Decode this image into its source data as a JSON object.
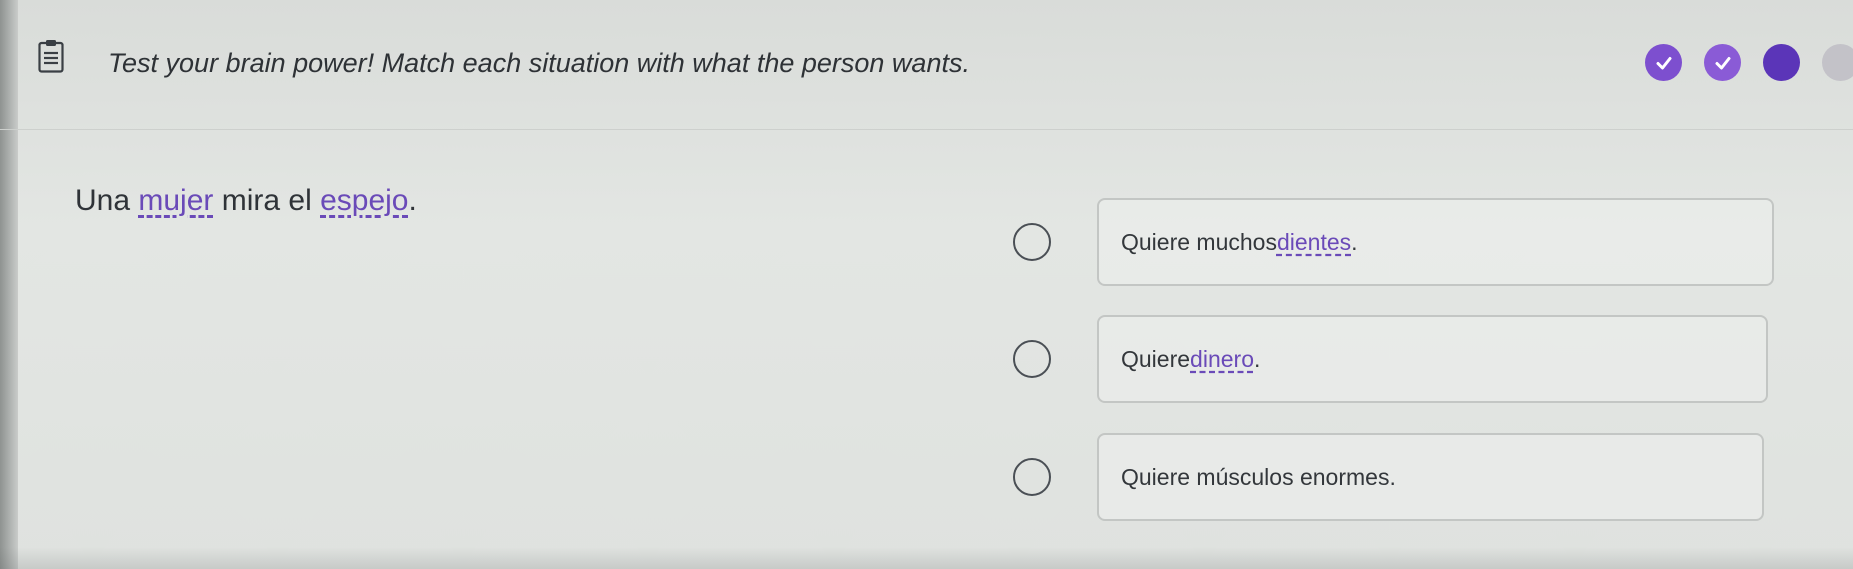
{
  "header": {
    "instruction": "Test your brain power! Match each situation with what the person wants.",
    "progress": [
      {
        "state": "done",
        "icon": "checkmark-icon"
      },
      {
        "state": "done",
        "icon": "checkmark-icon"
      },
      {
        "state": "current"
      },
      {
        "state": "todo"
      }
    ]
  },
  "question": {
    "parts": [
      "Una ",
      "mujer",
      " mira el ",
      "espejo",
      "."
    ]
  },
  "options": [
    {
      "parts": [
        "Quiere muchos ",
        "dientes",
        "."
      ]
    },
    {
      "parts": [
        "Quiere ",
        "dinero",
        "."
      ]
    },
    {
      "parts": [
        "Quiere músculos enormes."
      ]
    }
  ],
  "colors": {
    "accent": "#7d4fcf",
    "current": "#5b35b8",
    "todo": "#c3c2c8",
    "vocab": "#6a4ab8"
  }
}
